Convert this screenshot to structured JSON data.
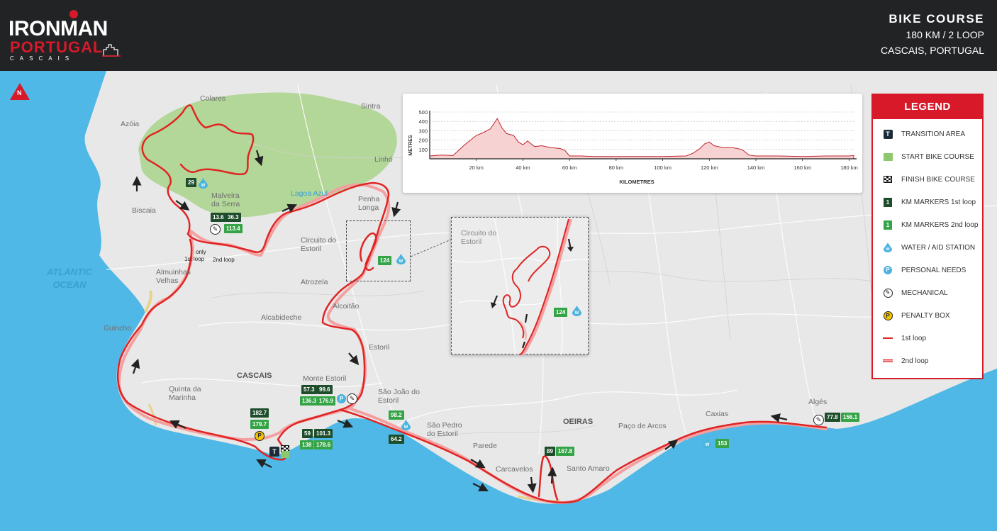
{
  "header": {
    "brand": "IRONMAN",
    "brand_location": "PORTUGAL",
    "brand_city": "CASCAIS",
    "course_title": "BIKE COURSE",
    "course_distance": "180 KM / 2 LOOP",
    "course_location": "CASCAIS, PORTUGAL"
  },
  "map": {
    "north": "N",
    "ocean": "ATLANTIC OCEAN",
    "places": [
      "Colares",
      "Sintra",
      "Azóia",
      "Linhó",
      "Malveira da Serra",
      "Lagoa Azul",
      "Penha Longa",
      "Biscaia",
      "Circuito do Estoril",
      "Atrozela",
      "Almuinhas Velhas",
      "Alcabideche",
      "Alcoitão",
      "Guincho",
      "Estoril",
      "CASCAIS",
      "Monte Estoril",
      "São João do Estoril",
      "Quinta da Marinha",
      "São Pedro do Estoril",
      "OEIRAS",
      "Paço de Arcos",
      "Caxias",
      "Algés",
      "Parede",
      "Carcavelos",
      "Santo Amaro"
    ],
    "route_notes": {
      "only": "only",
      "loop1": "1st loop",
      "loop2": "2nd loop"
    },
    "km_markers": [
      {
        "label": "29",
        "loop": 1
      },
      {
        "label": "13.6",
        "loop": 1
      },
      {
        "label": "36.3",
        "loop": 1
      },
      {
        "label": "113.4",
        "loop": 2
      },
      {
        "label": "124",
        "loop": 2
      },
      {
        "label": "57.3",
        "loop": 1
      },
      {
        "label": "99.6",
        "loop": 1
      },
      {
        "label": "136.3",
        "loop": 2
      },
      {
        "label": "176.9",
        "loop": 2
      },
      {
        "label": "182.7",
        "loop": 1
      },
      {
        "label": "179.7",
        "loop": 2
      },
      {
        "label": "59",
        "loop": 1
      },
      {
        "label": "101.3",
        "loop": 1
      },
      {
        "label": "138",
        "loop": 2
      },
      {
        "label": "178.6",
        "loop": 2
      },
      {
        "label": "98.2",
        "loop": 2
      },
      {
        "label": "64.2",
        "loop": 1
      },
      {
        "label": "89",
        "loop": 1
      },
      {
        "label": "167.8",
        "loop": 2
      },
      {
        "label": "153",
        "loop": 2
      },
      {
        "label": "77.8",
        "loop": 1
      },
      {
        "label": "156.1",
        "loop": 2
      }
    ],
    "inset": {
      "title": "Circuito do Estoril",
      "marker": "124"
    }
  },
  "elevation": {
    "y_label": "METRES",
    "x_label": "KILOMETRES",
    "y_ticks": [
      "500",
      "400",
      "300",
      "200",
      "100"
    ],
    "x_ticks": [
      "20 km",
      "40 km",
      "60 km",
      "80 km",
      "100 km",
      "120 km",
      "140 km",
      "160 km",
      "180 km"
    ],
    "chart_data": {
      "type": "area",
      "xlabel": "KILOMETRES",
      "ylabel": "METRES",
      "ylim": [
        0,
        500
      ],
      "xlim": [
        0,
        182
      ],
      "x": [
        0,
        5,
        10,
        15,
        20,
        23,
        26,
        29,
        31,
        33,
        36,
        38,
        40,
        42,
        45,
        48,
        52,
        56,
        58,
        60,
        65,
        70,
        80,
        90,
        100,
        110,
        113,
        116,
        118,
        120,
        122,
        126,
        130,
        134,
        137,
        140,
        150,
        160,
        170,
        180,
        182
      ],
      "y": [
        30,
        40,
        35,
        150,
        250,
        280,
        320,
        430,
        330,
        270,
        250,
        180,
        150,
        190,
        130,
        140,
        120,
        110,
        90,
        30,
        30,
        25,
        25,
        25,
        25,
        30,
        60,
        110,
        160,
        180,
        140,
        120,
        120,
        100,
        40,
        30,
        30,
        25,
        30,
        30,
        35
      ]
    }
  },
  "legend": {
    "title": "LEGEND",
    "items": [
      {
        "symbol": "T",
        "label": "TRANSITION AREA"
      },
      {
        "symbol": "",
        "label": "START BIKE COURSE"
      },
      {
        "symbol": "",
        "label": "FINISH BIKE COURSE"
      },
      {
        "symbol": "1",
        "label": "KM MARKERS 1st loop"
      },
      {
        "symbol": "1",
        "label": "KM MARKERS 2nd loop"
      },
      {
        "symbol": "W",
        "label": "WATER / AID STATION"
      },
      {
        "symbol": "P",
        "label": "PERSONAL NEEDS"
      },
      {
        "symbol": "",
        "label": "MECHANICAL"
      },
      {
        "symbol": "P",
        "label": "PENALTY BOX"
      },
      {
        "symbol": "",
        "label": "1st loop"
      },
      {
        "symbol": "",
        "label": "2nd loop"
      }
    ]
  },
  "colors": {
    "route_1st": "#e02424",
    "route_2nd": "#f4a0a0",
    "sea": "#4fb8e6",
    "land": "#e8e8e8",
    "park": "#a9d48a",
    "brand_red": "#d7192a"
  }
}
